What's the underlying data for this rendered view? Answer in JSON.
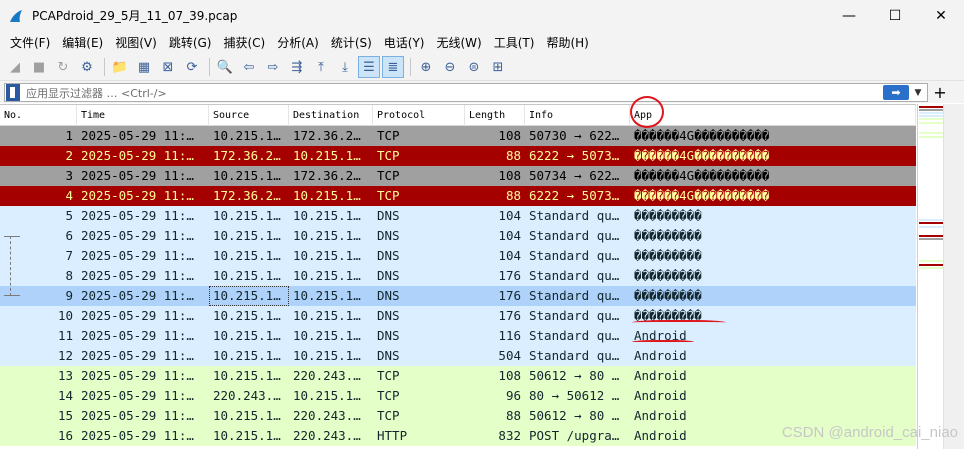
{
  "window": {
    "title": "PCAPdroid_29_5月_11_07_39.pcap",
    "minimize": "—",
    "maximize": "☐",
    "close": "✕"
  },
  "menu": [
    "文件(F)",
    "编辑(E)",
    "视图(V)",
    "跳转(G)",
    "捕获(C)",
    "分析(A)",
    "统计(S)",
    "电话(Y)",
    "无线(W)",
    "工具(T)",
    "帮助(H)"
  ],
  "toolbar": [
    {
      "name": "start-capture-icon",
      "glyph": "◢",
      "state": "disabled"
    },
    {
      "name": "stop-capture-icon",
      "glyph": "■",
      "state": "disabled"
    },
    {
      "name": "restart-capture-icon",
      "glyph": "↻",
      "state": "disabled"
    },
    {
      "name": "capture-options-icon",
      "glyph": "⚙",
      "state": "normal"
    },
    {
      "name": "sep"
    },
    {
      "name": "open-file-icon",
      "glyph": "📁",
      "state": "normal"
    },
    {
      "name": "save-file-icon",
      "glyph": "▦",
      "state": "normal"
    },
    {
      "name": "close-file-icon",
      "glyph": "⊠",
      "state": "normal"
    },
    {
      "name": "reload-file-icon",
      "glyph": "⟳",
      "state": "normal"
    },
    {
      "name": "sep"
    },
    {
      "name": "find-packet-icon",
      "glyph": "🔍",
      "state": "normal"
    },
    {
      "name": "go-back-icon",
      "glyph": "⇦",
      "state": "normal"
    },
    {
      "name": "go-forward-icon",
      "glyph": "⇨",
      "state": "normal"
    },
    {
      "name": "go-to-packet-icon",
      "glyph": "⇶",
      "state": "normal"
    },
    {
      "name": "go-first-icon",
      "glyph": "⤒",
      "state": "normal"
    },
    {
      "name": "go-last-icon",
      "glyph": "⤓",
      "state": "normal"
    },
    {
      "name": "auto-scroll-icon",
      "glyph": "☰",
      "state": "active"
    },
    {
      "name": "colorize-icon",
      "glyph": "≣",
      "state": "active"
    },
    {
      "name": "sep"
    },
    {
      "name": "zoom-in-icon",
      "glyph": "⊕",
      "state": "normal"
    },
    {
      "name": "zoom-out-icon",
      "glyph": "⊖",
      "state": "normal"
    },
    {
      "name": "zoom-normal-icon",
      "glyph": "⊜",
      "state": "normal"
    },
    {
      "name": "resize-columns-icon",
      "glyph": "⊞",
      "state": "normal"
    }
  ],
  "filter": {
    "placeholder": "应用显示过滤器 … <Ctrl-/>",
    "apply": "➡",
    "dropdown": "▼",
    "add": "+"
  },
  "columns": [
    "No.",
    "Time",
    "Source",
    "Destination",
    "Protocol",
    "Length",
    "Info",
    "App"
  ],
  "packets": [
    {
      "no": "1",
      "time": "2025-05-29 11:…",
      "src": "10.215.1…",
      "dst": "172.36.2…",
      "proto": "TCP",
      "len": "108",
      "info": "50730 → 622…",
      "app": "������4G����������",
      "style": "gray"
    },
    {
      "no": "2",
      "time": "2025-05-29 11:…",
      "src": "172.36.2…",
      "dst": "10.215.1…",
      "proto": "TCP",
      "len": "88",
      "info": "6222 → 5073…",
      "app": "������4G����������",
      "style": "red"
    },
    {
      "no": "3",
      "time": "2025-05-29 11:…",
      "src": "10.215.1…",
      "dst": "172.36.2…",
      "proto": "TCP",
      "len": "108",
      "info": "50734 → 622…",
      "app": "������4G����������",
      "style": "gray"
    },
    {
      "no": "4",
      "time": "2025-05-29 11:…",
      "src": "172.36.2…",
      "dst": "10.215.1…",
      "proto": "TCP",
      "len": "88",
      "info": "6222 → 5073…",
      "app": "������4G����������",
      "style": "red"
    },
    {
      "no": "5",
      "time": "2025-05-29 11:…",
      "src": "10.215.1…",
      "dst": "10.215.1…",
      "proto": "DNS",
      "len": "104",
      "info": "Standard qu…",
      "app": "���������",
      "style": "blue"
    },
    {
      "no": "6",
      "time": "2025-05-29 11:…",
      "src": "10.215.1…",
      "dst": "10.215.1…",
      "proto": "DNS",
      "len": "104",
      "info": "Standard qu…",
      "app": "���������",
      "style": "blue"
    },
    {
      "no": "7",
      "time": "2025-05-29 11:…",
      "src": "10.215.1…",
      "dst": "10.215.1…",
      "proto": "DNS",
      "len": "104",
      "info": "Standard qu…",
      "app": "���������",
      "style": "blue"
    },
    {
      "no": "8",
      "time": "2025-05-29 11:…",
      "src": "10.215.1…",
      "dst": "10.215.1…",
      "proto": "DNS",
      "len": "176",
      "info": "Standard qu…",
      "app": "���������",
      "style": "blue"
    },
    {
      "no": "9",
      "time": "2025-05-29 11:…",
      "src": "10.215.1…",
      "dst": "10.215.1…",
      "proto": "DNS",
      "len": "176",
      "info": "Standard qu…",
      "app": "���������",
      "style": "selected"
    },
    {
      "no": "10",
      "time": "2025-05-29 11:…",
      "src": "10.215.1…",
      "dst": "10.215.1…",
      "proto": "DNS",
      "len": "176",
      "info": "Standard qu…",
      "app": "���������",
      "style": "blue"
    },
    {
      "no": "11",
      "time": "2025-05-29 11:…",
      "src": "10.215.1…",
      "dst": "10.215.1…",
      "proto": "DNS",
      "len": "116",
      "info": "Standard qu…",
      "app": "Android",
      "style": "blue"
    },
    {
      "no": "12",
      "time": "2025-05-29 11:…",
      "src": "10.215.1…",
      "dst": "10.215.1…",
      "proto": "DNS",
      "len": "504",
      "info": "Standard qu…",
      "app": "Android",
      "style": "blue"
    },
    {
      "no": "13",
      "time": "2025-05-29 11:…",
      "src": "10.215.1…",
      "dst": "220.243.…",
      "proto": "TCP",
      "len": "108",
      "info": "50612 → 80 …",
      "app": "Android",
      "style": "green"
    },
    {
      "no": "14",
      "time": "2025-05-29 11:…",
      "src": "220.243.…",
      "dst": "10.215.1…",
      "proto": "TCP",
      "len": "96",
      "info": "80 → 50612 …",
      "app": "Android",
      "style": "green"
    },
    {
      "no": "15",
      "time": "2025-05-29 11:…",
      "src": "10.215.1…",
      "dst": "220.243.…",
      "proto": "TCP",
      "len": "88",
      "info": "50612 → 80 …",
      "app": "Android",
      "style": "green"
    },
    {
      "no": "16",
      "time": "2025-05-29 11:…",
      "src": "10.215.1…",
      "dst": "220.243.…",
      "proto": "HTTP",
      "len": "832",
      "info": "POST /upgra…",
      "app": "Android",
      "style": "green"
    }
  ],
  "colors": {
    "gray": "#a0a0a0",
    "red": "#a40000",
    "blue": "#daeeff",
    "selected": "#aed2fa",
    "green": "#e4ffc7",
    "annotation": "#e0161d"
  },
  "watermark": "CSDN @android_cai_niao"
}
